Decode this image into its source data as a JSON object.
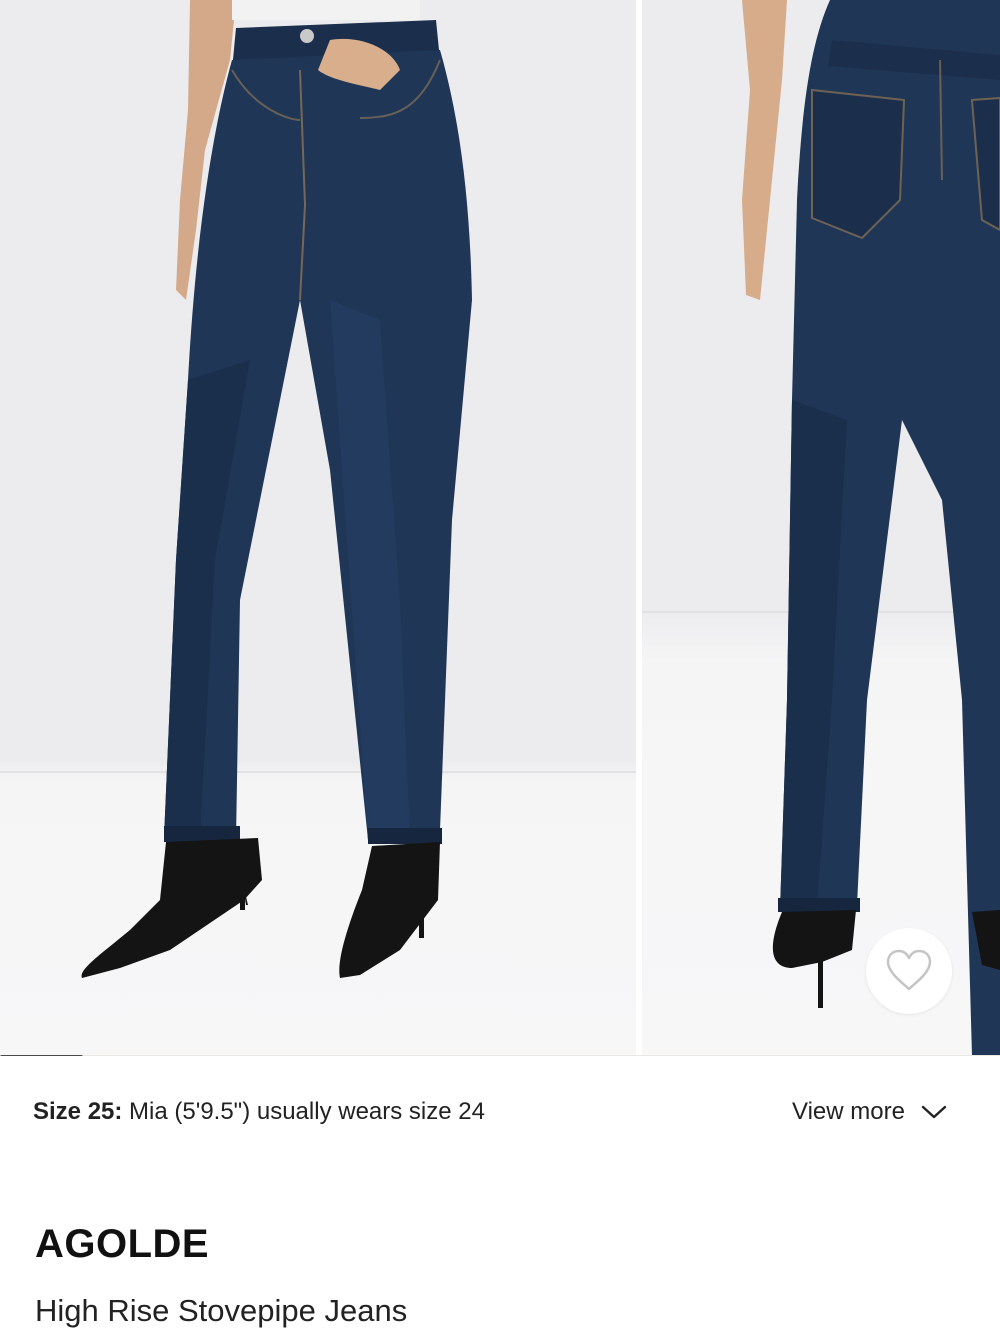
{
  "gallery": {
    "images": [
      {
        "alt": "Front view of dark wash high rise straight leg jeans with black pointed ankle boots"
      },
      {
        "alt": "Back view of dark wash high rise jeans with black pointed heels"
      }
    ],
    "progress": 0.083
  },
  "favorite": {
    "icon": "heart-outline-icon"
  },
  "fit": {
    "size_label": "Size 25:",
    "model_info": " Mia (5'9.5\") usually wears size 24",
    "view_more_label": "View more",
    "view_more_icon": "chevron-down-icon"
  },
  "product": {
    "brand": "AGOLDE",
    "name": "High Rise Stovepipe Jeans"
  },
  "colors": {
    "denim": "#1f3656",
    "denim_dark": "#16263f",
    "boot": "#141414",
    "skin": "#d8ae8c",
    "wall": "#ececee",
    "floor": "#f7f7f8"
  }
}
